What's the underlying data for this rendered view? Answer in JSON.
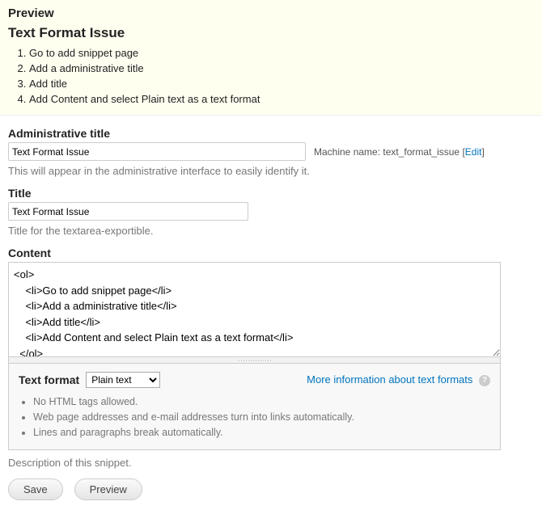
{
  "preview": {
    "heading": "Preview",
    "title": "Text Format Issue",
    "items": [
      "Go to add snippet page",
      "Add a administrative title",
      "Add title",
      "Add Content and select Plain text as a text format"
    ]
  },
  "admin_title": {
    "label": "Administrative title",
    "value": "Text Format Issue",
    "machine_prefix": "Machine name: ",
    "machine_name": "text_format_issue",
    "edit_label": "Edit",
    "description": "This will appear in the administrative interface to easily identify it."
  },
  "title": {
    "label": "Title",
    "value": "Text Format Issue",
    "description": "Title for the textarea-exportible."
  },
  "content": {
    "label": "Content",
    "value": "<ol>\n    <li>Go to add snippet page</li>\n    <li>Add a administrative title</li>\n    <li>Add title</li>\n    <li>Add Content and select Plain text as a text format</li>\n  </ol>"
  },
  "text_format": {
    "label": "Text format",
    "selected": "Plain text",
    "more_link": "More information about text formats",
    "tips": [
      "No HTML tags allowed.",
      "Web page addresses and e-mail addresses turn into links automatically.",
      "Lines and paragraphs break automatically."
    ]
  },
  "snippet_description": "Description of this snippet.",
  "buttons": {
    "save": "Save",
    "preview": "Preview"
  }
}
